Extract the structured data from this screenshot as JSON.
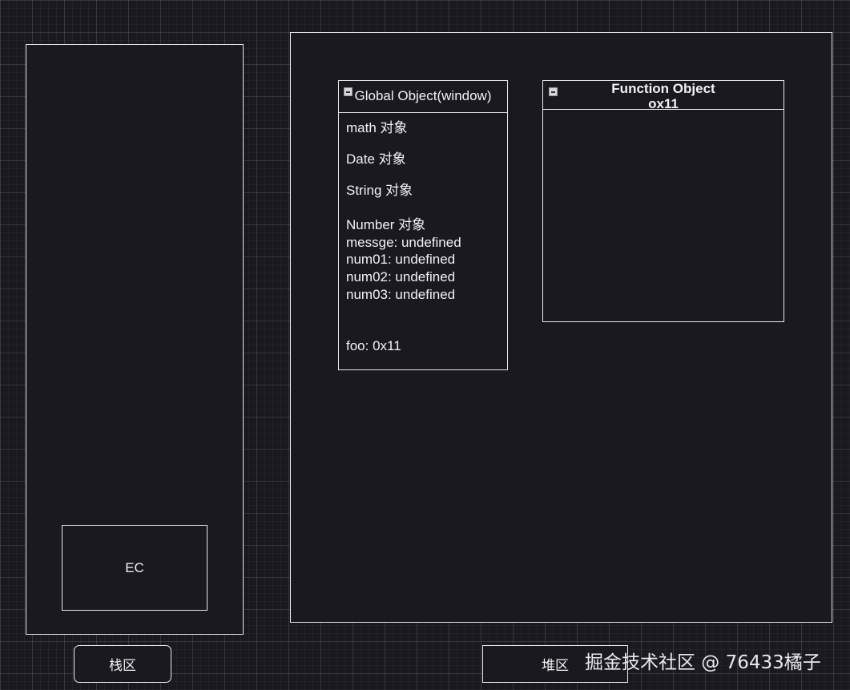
{
  "stack_region": {
    "ec_label": "EC",
    "label": "栈区"
  },
  "heap_region": {
    "label": "堆区",
    "global_object": {
      "title": "Global Object(window)",
      "fields": [
        "math 对象",
        "Date 对象",
        "String 对象",
        "Number 对象",
        "messge: undefined",
        "num01: undefined",
        "num02: undefined",
        "num03: undefined",
        "foo: 0x11"
      ]
    },
    "function_object": {
      "title_line1": "Function Object",
      "title_line2": "ox11"
    }
  },
  "watermark": "掘金技术社区 @ 76433橘子"
}
